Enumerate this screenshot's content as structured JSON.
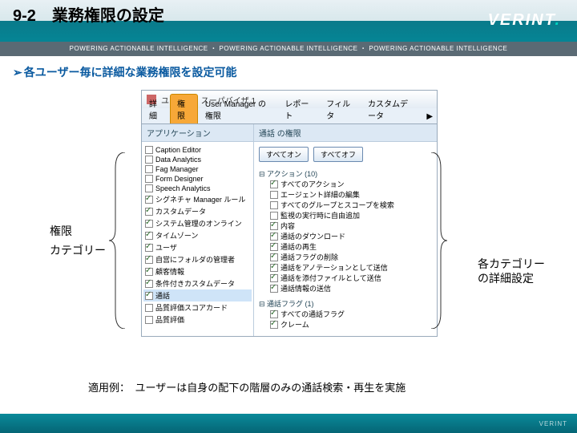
{
  "header": {
    "title": "9-2　業務権限の設定",
    "logo": "VERINT"
  },
  "tagline": "POWERING ACTIONABLE INTELLIGENCE ・ POWERING ACTIONABLE INTELLIGENCE ・ POWERING ACTIONABLE INTELLIGENCE",
  "bullet": "各ユーザー毎に詳細な業務権限を設定可能",
  "window_title": "ユーザー：スーパバイザ 1",
  "tabs": [
    "詳細",
    "権限",
    "User Manager の権限",
    "レポート",
    "フィルタ",
    "カスタムデータ"
  ],
  "active_tab": 1,
  "left_panel_header": "アプリケーション",
  "right_panel_header": "通話 の権限",
  "buttons": {
    "all_on": "すべてオン",
    "all_off": "すべてオフ"
  },
  "categories": [
    {
      "label": "Caption Editor",
      "checked": false
    },
    {
      "label": "Data Analytics",
      "checked": false
    },
    {
      "label": "Fag Manager",
      "checked": false
    },
    {
      "label": "Form Designer",
      "checked": false
    },
    {
      "label": "Speech Analytics",
      "checked": false
    },
    {
      "label": "シグネチャ Manager ルール",
      "checked": true
    },
    {
      "label": "カスタムデータ",
      "checked": true
    },
    {
      "label": "システム管理のオンライン",
      "checked": true
    },
    {
      "label": "タイムゾーン",
      "checked": true
    },
    {
      "label": "ユーザ",
      "checked": true
    },
    {
      "label": "自営にフォルダの管理者",
      "checked": true
    },
    {
      "label": "顧客情報",
      "checked": true
    },
    {
      "label": "条件付きカスタムデータ",
      "checked": true
    },
    {
      "label": "通話",
      "checked": true,
      "selected": true
    },
    {
      "label": "品質評価スコアカード",
      "checked": false
    },
    {
      "label": "品質評価",
      "checked": false
    }
  ],
  "actions_group": {
    "title": "アクション (10)",
    "items": [
      {
        "label": "すべてのアクション",
        "checked": true
      },
      {
        "label": "エージェント詳細の編集",
        "checked": false
      },
      {
        "label": "すべてのグループとスコープを検索",
        "checked": false
      },
      {
        "label": "監視の実行時に自由追加",
        "checked": false
      },
      {
        "label": "内容",
        "checked": true
      },
      {
        "label": "通話のダウンロード",
        "checked": true
      },
      {
        "label": "通話の再生",
        "checked": true
      },
      {
        "label": "通話フラグの削除",
        "checked": true
      },
      {
        "label": "通話をアノテーションとして送信",
        "checked": true
      },
      {
        "label": "通話を添付ファイルとして送信",
        "checked": true
      },
      {
        "label": "通話情報の送信",
        "checked": true
      }
    ]
  },
  "flags_group": {
    "title": "通話フラグ (1)",
    "items": [
      {
        "label": "すべての通話フラグ",
        "checked": true
      },
      {
        "label": "クレーム",
        "checked": true
      }
    ]
  },
  "labels": {
    "left1": "権限",
    "left2": "カテゴリー",
    "right1": "各カテゴリー",
    "right2": "の詳細設定"
  },
  "footer": "適用例：　ユーザーは自身の配下の階層のみの通話検索・再生を実施",
  "bottom_logo": "VERINT"
}
